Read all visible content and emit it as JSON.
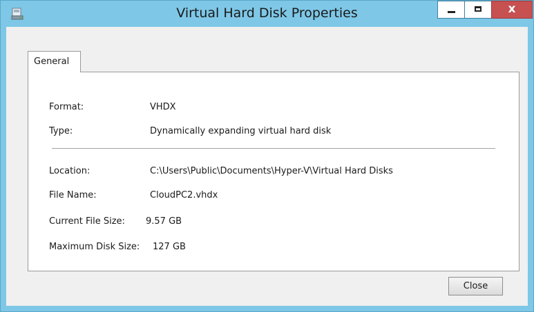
{
  "window": {
    "title": "Virtual Hard Disk Properties",
    "icon": "disk-properties-icon"
  },
  "tabs": [
    {
      "label": "General"
    }
  ],
  "properties": {
    "format_label": "Format:",
    "format_value": "VHDX",
    "type_label": "Type:",
    "type_value": "Dynamically expanding virtual hard disk",
    "location_label": "Location:",
    "location_value": "C:\\Users\\Public\\Documents\\Hyper-V\\Virtual Hard Disks",
    "filename_label": "File Name:",
    "filename_value": "CloudPC2.vhdx",
    "current_size_label": "Current File Size:",
    "current_size_value": "9.57 GB",
    "max_size_label": "Maximum Disk Size:",
    "max_size_value": "127 GB"
  },
  "buttons": {
    "close_label": "Close"
  },
  "caption_buttons": {
    "close_glyph": "x"
  },
  "colors": {
    "titlebar": "#7ec7e7",
    "close_caption": "#c75050"
  }
}
